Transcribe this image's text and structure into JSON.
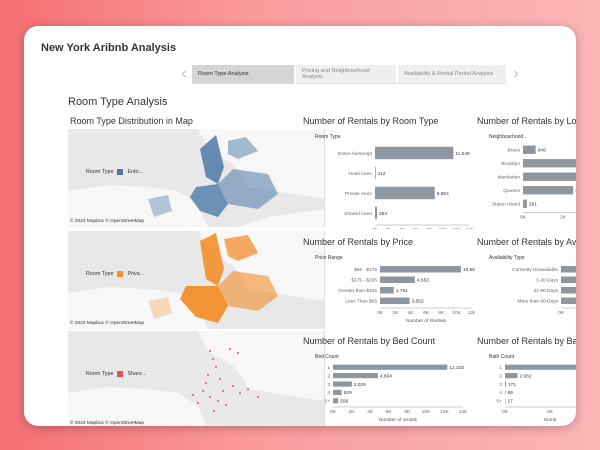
{
  "app_title": "New York Aribnb Analysis",
  "story": {
    "tabs": [
      "Room Type Analysis",
      "Pricing and Neighbourhood Analysis",
      "Availability & Rental Period Analysis"
    ],
    "active": 0
  },
  "dashboard_title": "Room Type Analysis",
  "map_section": {
    "title": "Room Type Distribution in Map",
    "maps": [
      {
        "legend_label": "Room Type",
        "value": "Entir...",
        "color": "#4e79a7",
        "credit": "© 2024 Mapbox  © OpenStreetMap"
      },
      {
        "legend_label": "Room Type",
        "value": "Priva...",
        "color": "#f28e2b",
        "credit": "© 2024 Mapbox  © OpenStreetMap"
      },
      {
        "legend_label": "Room Type",
        "value": "Share...",
        "color": "#e15759",
        "credit": "© 2024 Mapbox  © OpenStreetMap"
      }
    ]
  },
  "colors": {
    "bar": "#8e979f",
    "axis": "#999999"
  },
  "chart_data": [
    {
      "type": "bar",
      "title": "Number of Rentals by Room Type",
      "category_header": "Room Type",
      "categories": [
        "Entire home/apt",
        "Hotel room",
        "Private room",
        "Shared room"
      ],
      "values": [
        11549,
        112,
        8804,
        293
      ],
      "value_labels": [
        "11,549",
        "112",
        "8,804",
        "293"
      ],
      "ticks": [
        "0K",
        "2K",
        "4K",
        "6K",
        "8K",
        "10K",
        "12K",
        "14K"
      ],
      "xlim": [
        0,
        14000
      ],
      "xlabel": "Number of Rentals"
    },
    {
      "type": "bar",
      "title": "Number of Rentals by Loca",
      "category_header": "Neighbourhood..",
      "categories": [
        "Bronx",
        "Brooklyn",
        "Manhattan",
        "Queens",
        "Staten Island"
      ],
      "values": [
        949,
        8200,
        8700,
        3761,
        291
      ],
      "value_labels": [
        "949",
        "",
        "",
        "3,761",
        "291"
      ],
      "ticks": [
        "0K",
        "2K",
        "4K"
      ],
      "xlim": [
        0,
        6000
      ],
      "xlabel": ""
    },
    {
      "type": "bar",
      "title": "Number of Rentals by Price",
      "category_header": "Price Range",
      "categories": [
        "$65 - $175",
        "$175 - $335",
        "Greater than $335",
        "Less Than $65"
      ],
      "values": [
        10563,
        4553,
        1791,
        3852
      ],
      "value_labels": [
        "10,563",
        "4,553",
        "1,791",
        "3,852"
      ],
      "ticks": [
        "0K",
        "2K",
        "4K",
        "6K",
        "8K",
        "10K",
        "12K"
      ],
      "xlim": [
        0,
        12000
      ],
      "xlabel": "Number of Rentals"
    },
    {
      "type": "bar",
      "title": "Number of Rentals by Av",
      "category_header": "Availability Type",
      "categories": [
        "Currently Unavailable",
        "1-30 Days",
        "31-90 Days",
        "More than 90 Days"
      ],
      "values": [
        12000,
        3200,
        3900,
        6000
      ],
      "value_labels": [
        "",
        "",
        "",
        ""
      ],
      "ticks": [
        "0K",
        "5K"
      ],
      "xlim": [
        0,
        12000
      ],
      "xlabel": "Numb"
    },
    {
      "type": "bar",
      "title": "Number of Rentals by Bed Count",
      "category_header": "Bed Count",
      "categories": [
        "1",
        "2",
        "3",
        "4",
        "5+"
      ],
      "values": [
        12310,
        4834,
        2029,
        929,
        556
      ],
      "value_labels": [
        "12,310",
        "4,834",
        "2,029",
        "929",
        "556"
      ],
      "ticks": [
        "0K",
        "2K",
        "4K",
        "6K",
        "8K",
        "10K",
        "12K",
        "14K"
      ],
      "xlim": [
        0,
        14000
      ],
      "xlabel": "Number of rentals"
    },
    {
      "type": "bar",
      "title": "Number of Rentals by Bat",
      "category_header": "Bath Count",
      "categories": [
        "1",
        "2",
        "3",
        "4",
        "5+"
      ],
      "values": [
        16500,
        2082,
        171,
        69,
        17
      ],
      "value_labels": [
        "",
        "2,082",
        "171",
        "69",
        "17"
      ],
      "ticks": [
        "0K",
        "5K",
        "10K"
      ],
      "xlim": [
        0,
        15000
      ],
      "xlabel": "Numb"
    }
  ]
}
